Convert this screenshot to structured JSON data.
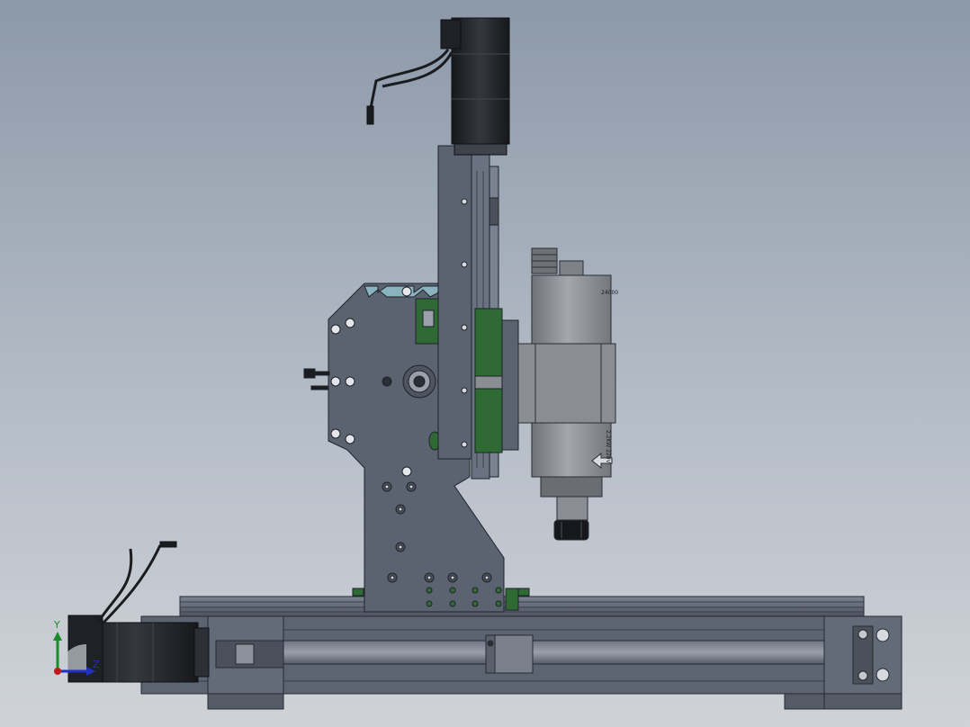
{
  "model": {
    "triad": {
      "y_label": "Y",
      "z_label": "Z"
    },
    "spindle": {
      "marking_top": "24000",
      "marking_side": "2.2KW 220V"
    }
  },
  "colors": {
    "background_top": "#8c99a9",
    "background_bottom": "#cfd3d8",
    "steel": "#5b6270",
    "steel_edge": "#2a2e35",
    "motor": "#22252a",
    "green_part": "#2f6a35",
    "spindle_body": "#8a8d93"
  },
  "icons": [
    "axis-triad-icon"
  ]
}
